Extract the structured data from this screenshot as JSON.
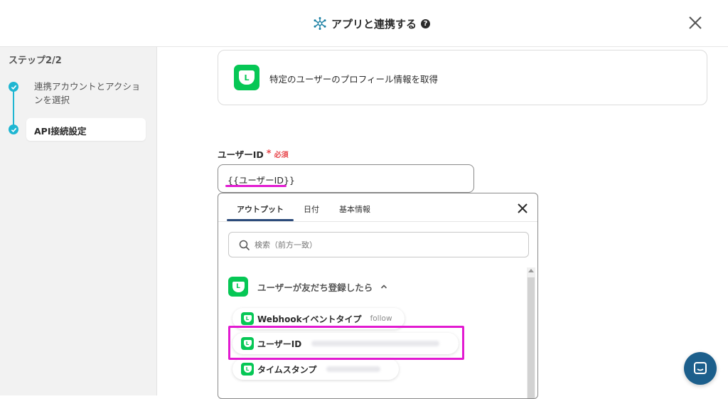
{
  "header": {
    "title": "アプリと連携する",
    "help_glyph": "?"
  },
  "sidebar": {
    "step_count": "ステップ2/2",
    "steps": [
      {
        "label": "連携アカウントとアクションを選択",
        "completed": true
      },
      {
        "label": "API接続設定",
        "completed": true,
        "active": true
      }
    ]
  },
  "action": {
    "icon": "line-app-icon",
    "icon_glyph": "L",
    "text": "特定のユーザーのプロフィール情報を取得"
  },
  "field": {
    "label": "ユーザーID",
    "required_mark": "*",
    "required_text": "必須",
    "value": "{{ユーザーID}}"
  },
  "panel": {
    "tabs": [
      {
        "label": "アウトプット",
        "active": true
      },
      {
        "label": "日付",
        "active": false
      },
      {
        "label": "基本情報",
        "active": false
      }
    ],
    "search_placeholder": "検索（前方一致）",
    "group": {
      "label": "ユーザーが友だち登録したら",
      "expanded": true
    },
    "items": [
      {
        "label": "Webhookイベントタイプ",
        "value": "follow",
        "value_blurred": false
      },
      {
        "label": "ユーザーID",
        "value_blurred": true,
        "highlighted": true
      },
      {
        "label": "タイムスタンプ",
        "value_blurred": true
      }
    ]
  },
  "colors": {
    "accent": "#1fb6d2",
    "line_green": "#06c755",
    "highlight": "#e21ad1",
    "required": "#e8484d",
    "chat_button": "#1c5f8c"
  }
}
